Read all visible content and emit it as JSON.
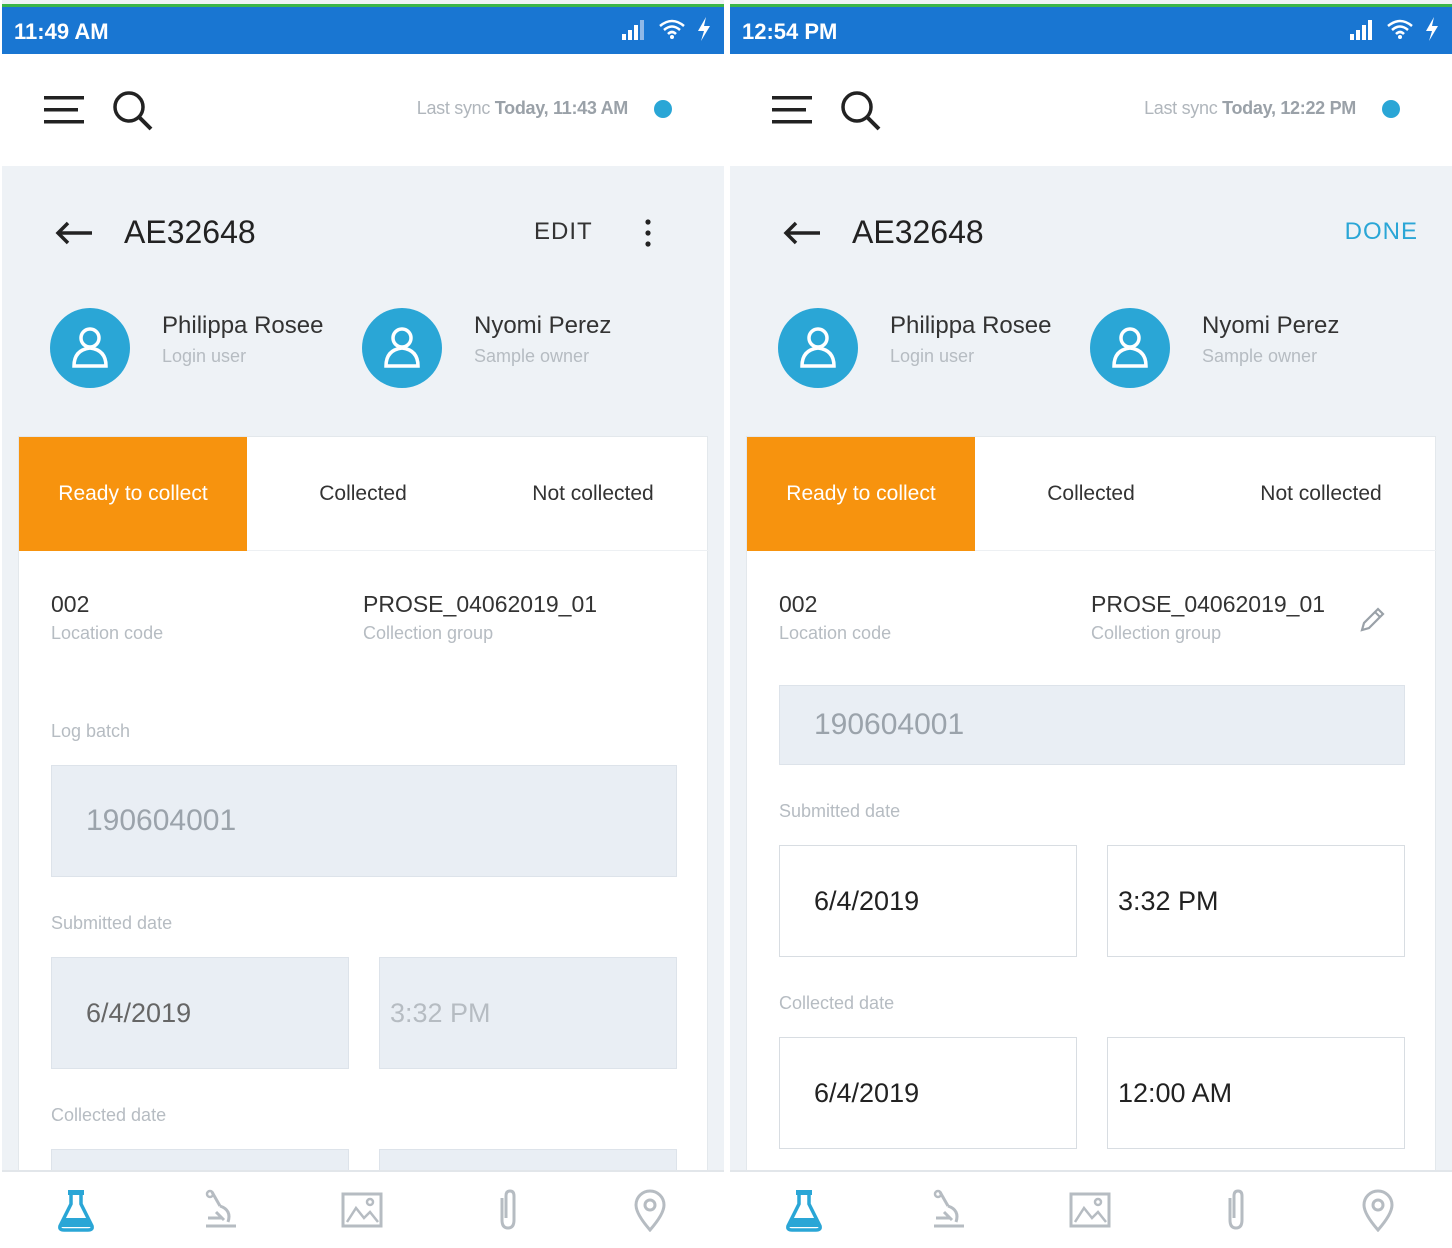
{
  "colors": {
    "status_bar": "#1976d2",
    "accent": "#2aa6d6",
    "active_tab": "#f7930e",
    "card_bg": "#ffffff",
    "page_bg": "#eef2f6"
  },
  "screens": [
    {
      "status_time": "11:49 AM",
      "sync_prefix": "Last sync",
      "sync_time": "Today, 11:43 AM",
      "sample_id": "AE32648",
      "action_label": "EDIT",
      "people": [
        {
          "name": "Philippa Rosee",
          "role": "Login user"
        },
        {
          "name": "Nyomi Perez",
          "role": "Sample owner"
        }
      ],
      "tabs": [
        "Ready to collect",
        "Collected",
        "Not collected"
      ],
      "location_code": {
        "value": "002",
        "label": "Location code"
      },
      "collection_group": {
        "value": "PROSE_04062019_01",
        "label": "Collection group"
      },
      "log_batch": {
        "label": "Log batch",
        "value": "190604001"
      },
      "submitted": {
        "label": "Submitted date",
        "date": "6/4/2019",
        "time": "3:32 PM"
      },
      "collected": {
        "label": "Collected date"
      }
    },
    {
      "status_time": "12:54 PM",
      "sync_prefix": "Last sync",
      "sync_time": "Today, 12:22 PM",
      "sample_id": "AE32648",
      "action_label": "DONE",
      "people": [
        {
          "name": "Philippa Rosee",
          "role": "Login user"
        },
        {
          "name": "Nyomi Perez",
          "role": "Sample owner"
        }
      ],
      "tabs": [
        "Ready to collect",
        "Collected",
        "Not collected"
      ],
      "location_code": {
        "value": "002",
        "label": "Location code"
      },
      "collection_group": {
        "value": "PROSE_04062019_01",
        "label": "Collection group"
      },
      "log_batch": {
        "value": "190604001"
      },
      "submitted": {
        "label": "Submitted date",
        "date": "6/4/2019",
        "time": "3:32 PM"
      },
      "collected": {
        "label": "Collected date",
        "date": "6/4/2019",
        "time": "12:00 AM"
      }
    }
  ],
  "bottom_nav_icons": [
    "flask-icon",
    "microscope-icon",
    "image-icon",
    "attachment-icon",
    "location-pin-icon"
  ]
}
